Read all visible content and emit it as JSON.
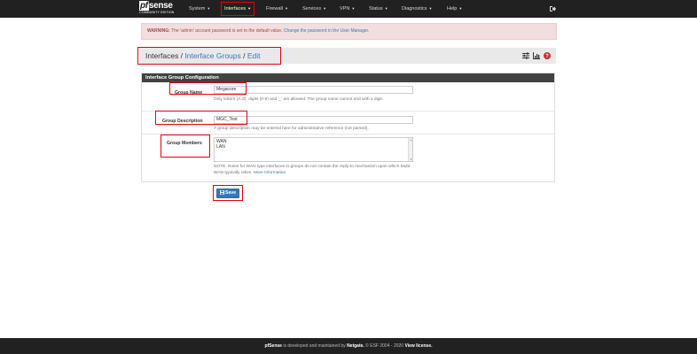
{
  "brand": {
    "prefix": "pf",
    "suffix": "sense",
    "edition": "COMMUNITY EDITION"
  },
  "nav": {
    "items": [
      {
        "label": "System"
      },
      {
        "label": "Interfaces"
      },
      {
        "label": "Firewall"
      },
      {
        "label": "Services"
      },
      {
        "label": "VPN"
      },
      {
        "label": "Status"
      },
      {
        "label": "Diagnostics"
      },
      {
        "label": "Help"
      }
    ],
    "active": "Interfaces"
  },
  "warning": {
    "title": "WARNING:",
    "text": " The 'admin' account password is set to the default value. ",
    "link": "Change the password in the User Manager."
  },
  "breadcrumb": {
    "root": "Interfaces /",
    "mid": "Interface Groups",
    "sep": "/",
    "last": "Edit"
  },
  "panel": {
    "title": "Interface Group Configuration",
    "group_name": {
      "label": "Group Name",
      "value": "Megacore",
      "help": "Only letters (A-Z), digits (0-9) and '_' are allowed. The group name cannot end with a digit."
    },
    "group_description": {
      "label": "Group Description",
      "value": "MGC_Test",
      "help": "A group description may be entered here for administrative reference (not parsed)."
    },
    "group_members": {
      "label": "Group Members",
      "options": [
        "WAN",
        "LAN"
      ],
      "help": "NOTE: Rules for WAN type interfaces in groups do not contain the reply-to mechanism upon which Multi-WAN typically relies. ",
      "help_link": "More Information"
    }
  },
  "save_label": "Save",
  "footer": {
    "brand": "pfSense",
    "text1": " is developed and maintained by ",
    "company": "Netgate.",
    "text2": " © ESF 2004 - 2020 ",
    "license": "View license."
  },
  "colors": {
    "navbar": "#212121",
    "accent": "#337ab7",
    "highlight": "#e8000d",
    "warning_bg": "#f2dede"
  }
}
